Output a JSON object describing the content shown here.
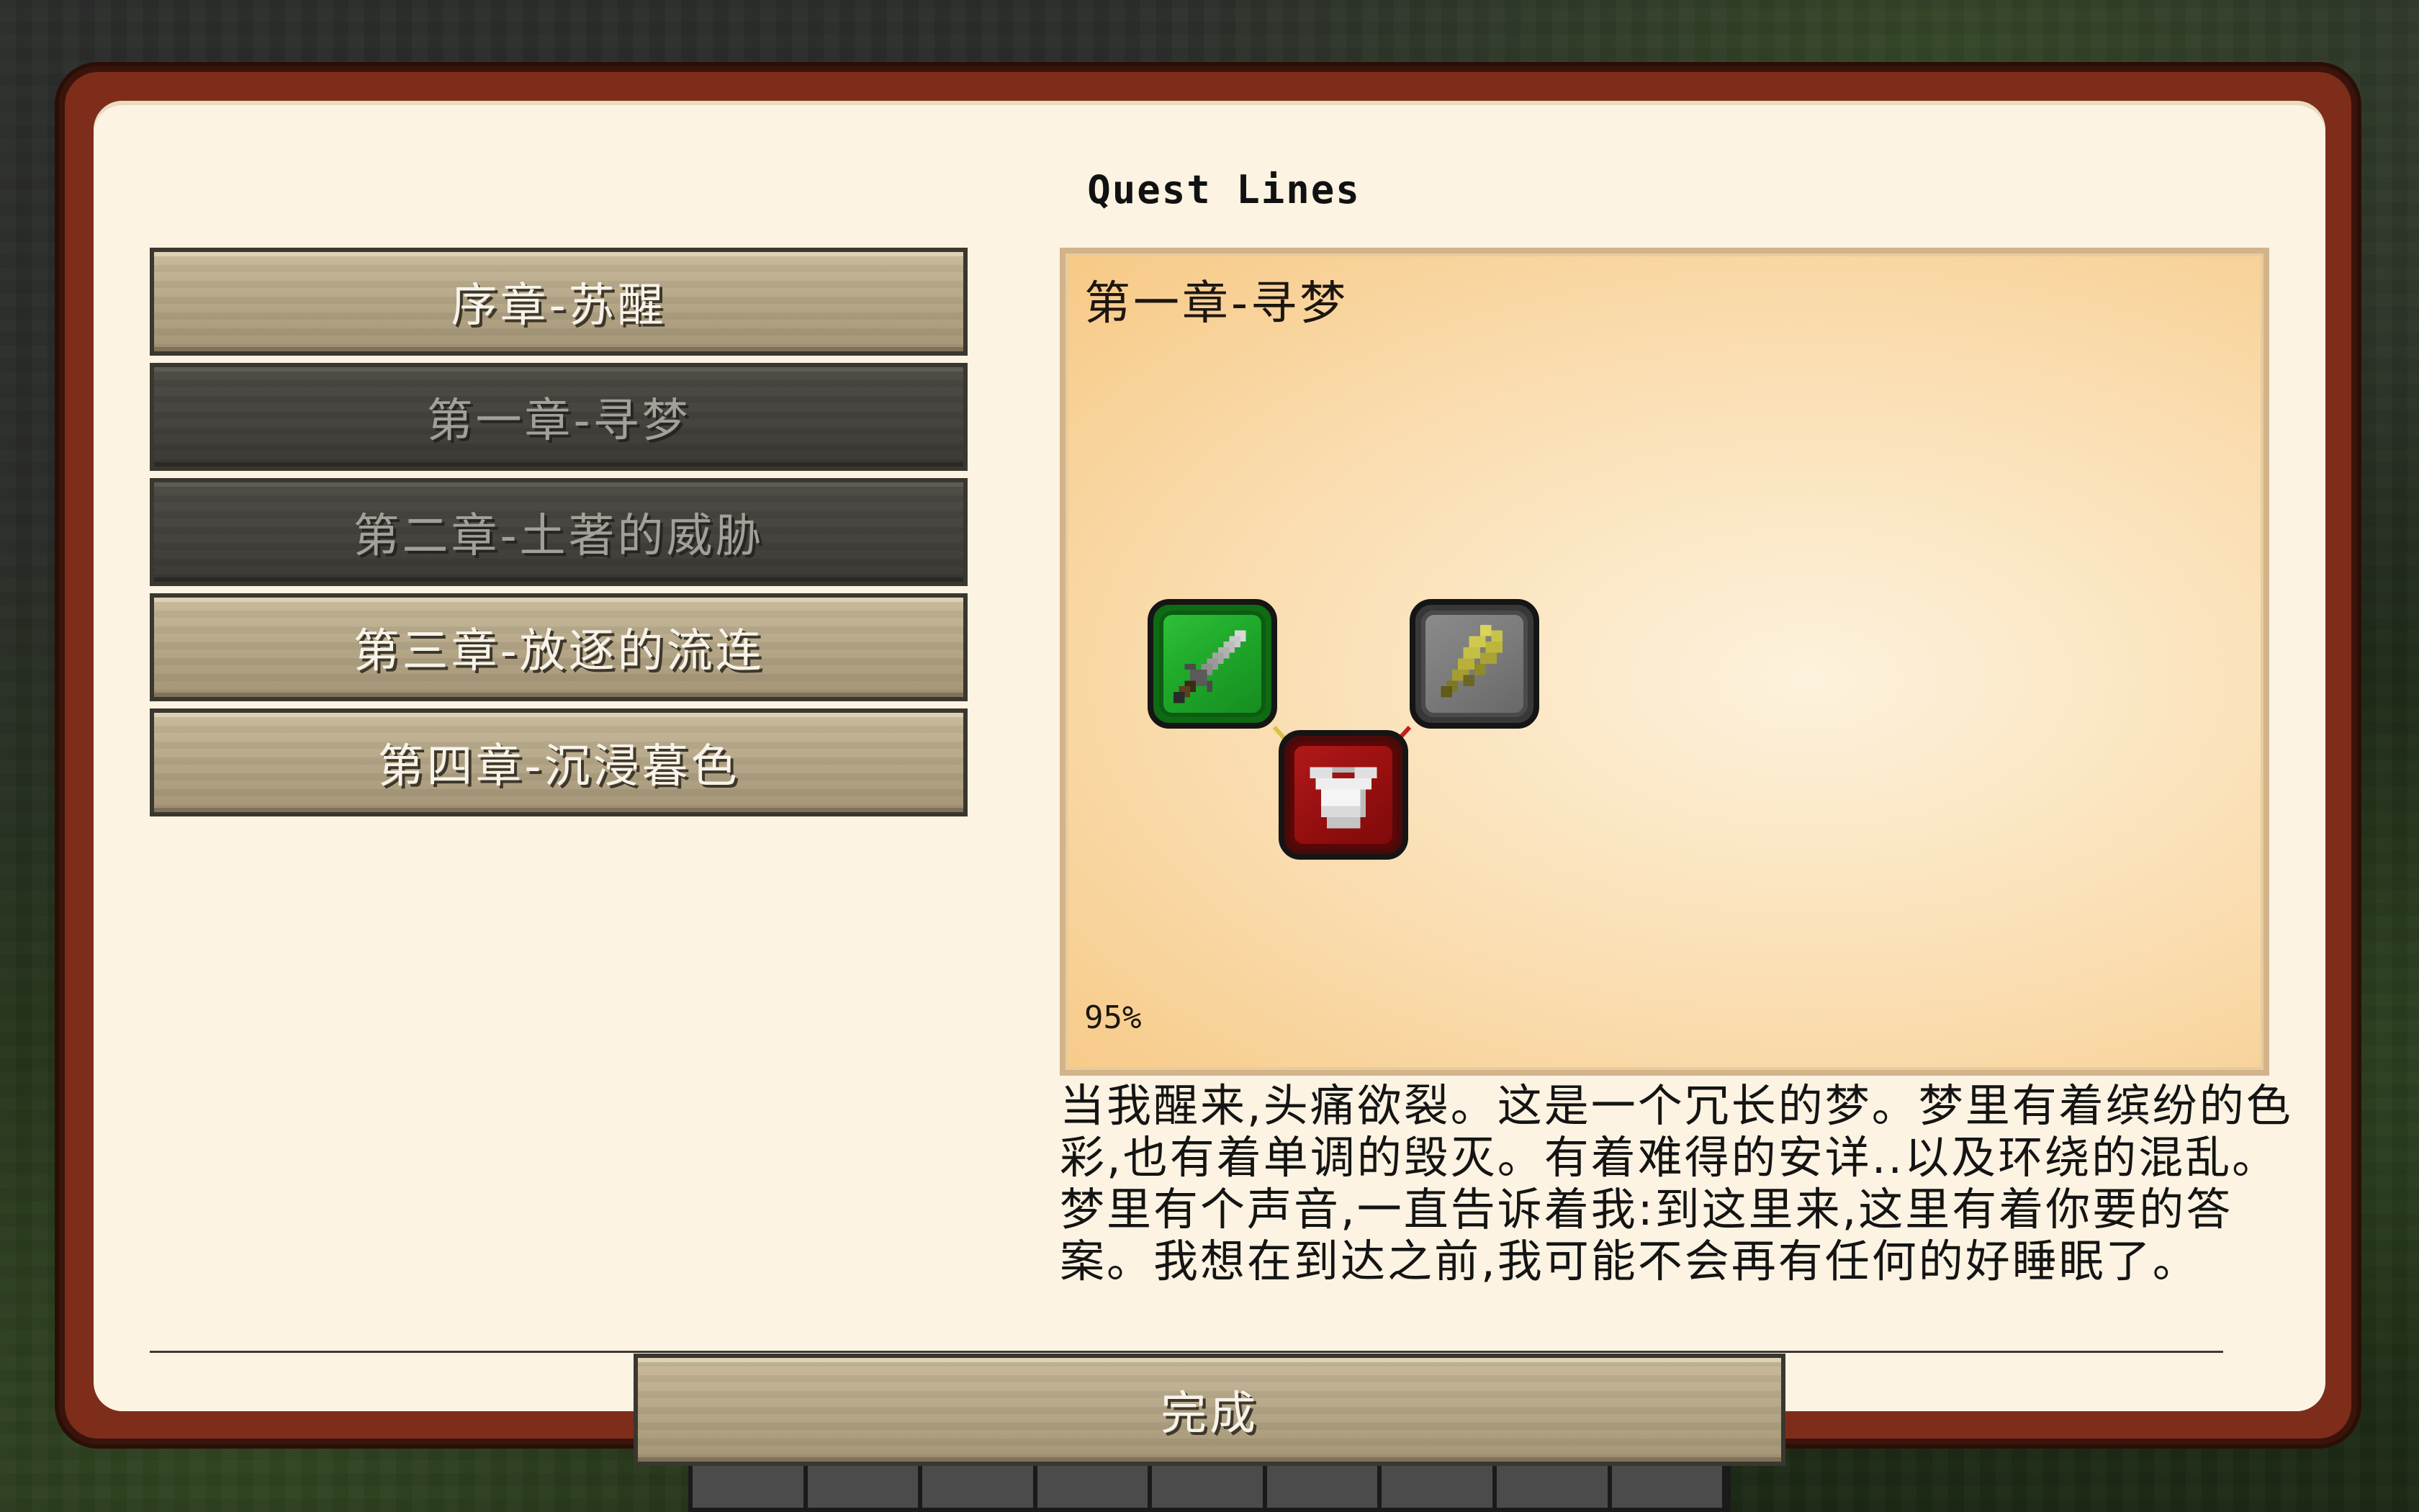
{
  "title": "Quest Lines",
  "quest_lines": [
    {
      "label": "序章-苏醒",
      "state": "unlocked"
    },
    {
      "label": "第一章-寻梦",
      "state": "selected"
    },
    {
      "label": "第二章-土著的威胁",
      "state": "locked"
    },
    {
      "label": "第三章-放逐的流连",
      "state": "unlocked"
    },
    {
      "label": "第四章-沉浸暮色",
      "state": "unlocked"
    }
  ],
  "map": {
    "title": "第一章-寻梦",
    "zoom": "95%",
    "nodes": [
      {
        "name": "sword-quest",
        "icon": "iron-sword-icon",
        "status": "complete",
        "color": "#1ea629"
      },
      {
        "name": "wheat-quest",
        "icon": "wheat-icon",
        "status": "unavailable",
        "color": "#7b7b7b"
      },
      {
        "name": "chestplate-quest",
        "icon": "chestplate-icon",
        "status": "incomplete",
        "color": "#960f0f"
      }
    ]
  },
  "description": "当我醒来,头痛欲裂。这是一个冗长的梦。梦里有着缤纷的色彩,也有着单调的毁灭。有着难得的安详..以及环绕的混乱。梦里有个声音,一直告诉着我:到这里来,这里有着你要的答案。我想在到达之前,我可能不会再有任何的好睡眠了。",
  "done_label": "完成"
}
